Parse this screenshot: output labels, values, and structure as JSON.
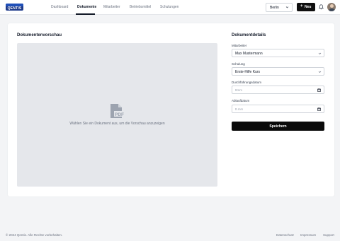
{
  "app": {
    "logo_text": "QENTIS"
  },
  "nav": {
    "items": [
      {
        "label": "Dashboard",
        "active": false
      },
      {
        "label": "Dokumente",
        "active": true
      },
      {
        "label": "Mitarbeiter",
        "active": false
      },
      {
        "label": "Betriebsmittel",
        "active": false
      },
      {
        "label": "Schulungen",
        "active": false
      }
    ]
  },
  "header": {
    "location_select": {
      "value": "Berlin",
      "icon": "chevron-down-icon"
    },
    "new_button": {
      "label": "Neu",
      "icon": "plus-icon"
    },
    "notification_icon": "bell-icon",
    "avatar_icon": "user-avatar"
  },
  "preview": {
    "title": "Dokumentenvorschau",
    "empty_icon": "pdf-file-icon",
    "empty_text": "Wählen Sie ein Dokument aus, um die Vorschau anzuzeigen"
  },
  "details": {
    "title": "Dokumentdetails",
    "fields": [
      {
        "label": "Mitarbeiter",
        "value": "Max Mustermann",
        "type": "select"
      },
      {
        "label": "Schulung",
        "value": "Erste-Hilfe Kurs",
        "type": "select"
      },
      {
        "label": "Durchführungsdatum",
        "placeholder": "ttmm",
        "type": "date"
      },
      {
        "label": "Ablaufdatum",
        "placeholder": "tt.mm",
        "type": "date"
      }
    ],
    "save_label": "Speichern"
  },
  "footer": {
    "copyright": "© 2024 Qentis. Alle Rechte vorbehalten.",
    "links": [
      "Datenschutz",
      "Impressum",
      "Support"
    ]
  },
  "colors": {
    "primary_button": "#0a0a0a",
    "logo_blue": "#1e3a8a",
    "page_bg": "#f3f4f6",
    "preview_bg": "#e5e7eb"
  }
}
